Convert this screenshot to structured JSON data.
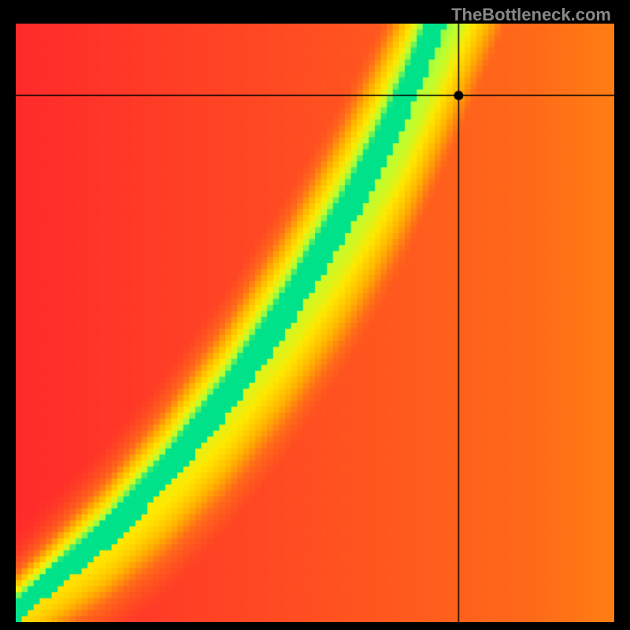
{
  "watermark": "TheBottleneck.com",
  "chart_data": {
    "type": "heatmap",
    "title": "",
    "xlabel": "",
    "ylabel": "",
    "xlim": [
      0,
      1
    ],
    "ylim": [
      0,
      1
    ],
    "marker": {
      "x": 0.74,
      "y": 0.88
    },
    "crosshair": {
      "x": 0.74,
      "y": 0.88
    },
    "ridge_curve": {
      "description": "locus of optimal (green) balance; y as function of x",
      "points": [
        [
          0.0,
          0.0
        ],
        [
          0.05,
          0.04
        ],
        [
          0.1,
          0.08
        ],
        [
          0.15,
          0.12
        ],
        [
          0.2,
          0.17
        ],
        [
          0.25,
          0.22
        ],
        [
          0.3,
          0.28
        ],
        [
          0.35,
          0.34
        ],
        [
          0.4,
          0.41
        ],
        [
          0.45,
          0.48
        ],
        [
          0.5,
          0.56
        ],
        [
          0.55,
          0.64
        ],
        [
          0.6,
          0.73
        ],
        [
          0.65,
          0.83
        ],
        [
          0.7,
          0.95
        ],
        [
          0.72,
          1.0
        ]
      ]
    },
    "color_stops": [
      {
        "t": 0.0,
        "color": "#ff2b2b"
      },
      {
        "t": 0.35,
        "color": "#ff6a1a"
      },
      {
        "t": 0.55,
        "color": "#ffb400"
      },
      {
        "t": 0.75,
        "color": "#ffe800"
      },
      {
        "t": 0.9,
        "color": "#b8ff33"
      },
      {
        "t": 1.0,
        "color": "#00e28a"
      }
    ],
    "falloff_width": 0.1,
    "pixel_resolution": 100
  }
}
